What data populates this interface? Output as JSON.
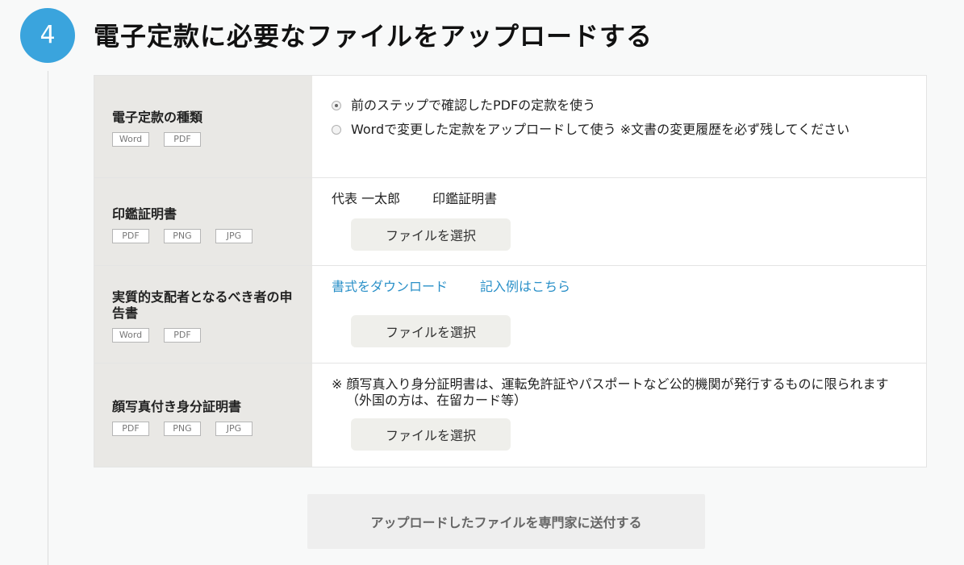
{
  "step": {
    "number": "4",
    "title": "電子定款に必要なファイルをアップロードする"
  },
  "rows": [
    {
      "label": "電子定款の種類",
      "badges": [
        "Word",
        "PDF"
      ],
      "options": [
        {
          "label": "前のステップで確認したPDFの定款を使う",
          "checked": true
        },
        {
          "label": "Wordで変更した定款をアップロードして使う ※文書の変更履歴を必ず残してください",
          "checked": false
        }
      ]
    },
    {
      "label": "印鑑証明書",
      "badges": [
        "PDF",
        "PNG",
        "JPG"
      ],
      "info_name": "代表 一太郎",
      "info_doc": "印鑑証明書",
      "button": "ファイルを選択"
    },
    {
      "label": "実質的支配者となるべき者の申告書",
      "badges": [
        "Word",
        "PDF"
      ],
      "link_download": "書式をダウンロード",
      "link_example": "記入例はこちら",
      "button": "ファイルを選択"
    },
    {
      "label": "顔写真付き身分証明書",
      "badges": [
        "PDF",
        "PNG",
        "JPG"
      ],
      "note": "※ 顔写真入り身分証明書は、運転免許証やパスポートなど公的機関が発行するものに限られます（外国の方は、在留カード等）",
      "button": "ファイルを選択"
    }
  ],
  "submit_label": "アップロードしたファイルを専門家に送付する",
  "colors": {
    "accent": "#3aa4dd",
    "link": "#2a90c8",
    "label_bg": "#e9e8e5"
  }
}
